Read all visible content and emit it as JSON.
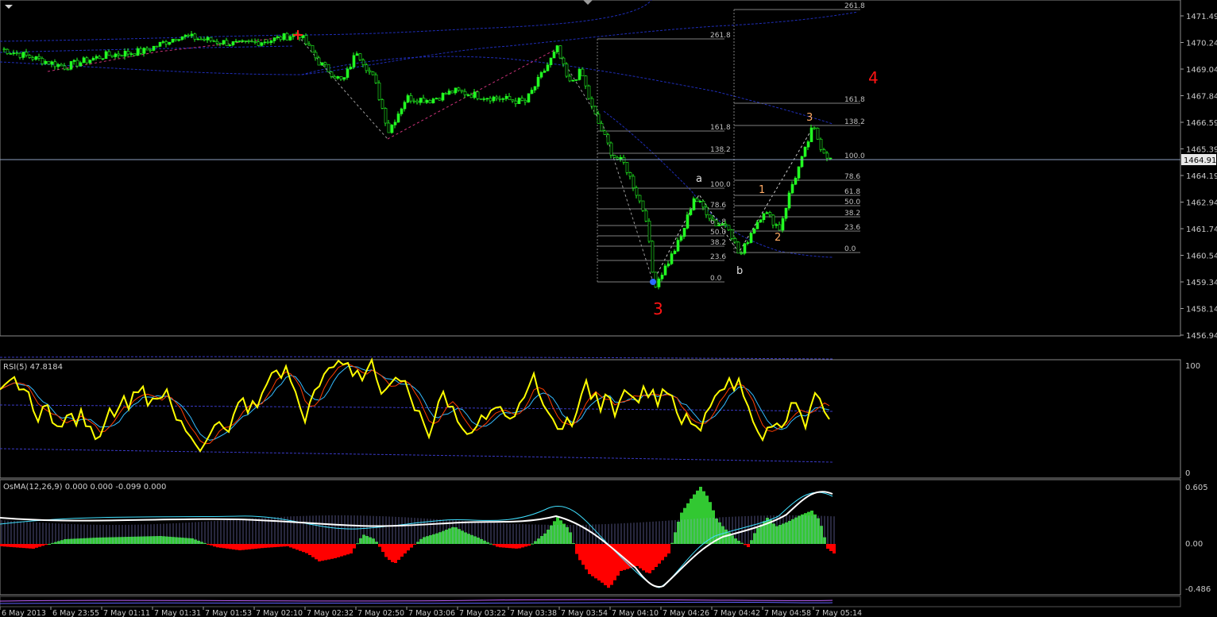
{
  "colors": {
    "background": "#000000",
    "grid": "#4c4c4c",
    "axis_text": "#c8c8c8",
    "bull_candle": "#22ff22",
    "bear_candle": "#00a800",
    "channel": "#1f2db8",
    "fib_line": "#808080",
    "fib_text": "#c0c0c0",
    "wave_major": "#ff1414",
    "wave_minor": "#ffaa64",
    "wave_letter": "#e0e0e0",
    "rsi_line": "#ffff00",
    "rsi_ma_fast": "#ff3c00",
    "rsi_ma_slow": "#33bbff",
    "rsi_band": "#3a3ac8",
    "osma_pos": "#32c832",
    "osma_neg": "#ff0000",
    "osma_signal_bar": "#a4a4ff",
    "macd_line": "#ffffff",
    "signal_line": "#40e0ff"
  },
  "price_axis": {
    "labels": [
      "1471.49",
      "1470.24",
      "1469.04",
      "1467.84",
      "1466.59",
      "1465.39",
      "1464.19",
      "1462.94",
      "1461.74",
      "1460.54",
      "1459.34",
      "1458.14",
      "1456.94"
    ],
    "current_price": "1464.91"
  },
  "time_axis": {
    "labels": [
      "6 May 2013",
      "6 May 23:55",
      "7 May 01:11",
      "7 May 01:31",
      "7 May 01:53",
      "7 May 02:10",
      "7 May 02:32",
      "7 May 02:50",
      "7 May 03:06",
      "7 May 03:22",
      "7 May 03:38",
      "7 May 03:54",
      "7 May 04:10",
      "7 May 04:26",
      "7 May 04:42",
      "7 May 04:58",
      "7 May 05:14"
    ]
  },
  "fib_sets": [
    {
      "levels": [
        "261.8",
        "161.8",
        "138.2",
        "100.0",
        "78.6",
        "61.8",
        "50.0",
        "38.2",
        "23.6",
        "0.0"
      ]
    },
    {
      "levels": [
        "261.8",
        "161.8",
        "138.2",
        "100.0",
        "78.6",
        "61.8",
        "50.0",
        "38.2",
        "23.6",
        "0.0"
      ]
    }
  ],
  "wave_labels": {
    "major_3": "3",
    "major_4": "4",
    "minor_1": "1",
    "minor_2": "2",
    "minor_3": "3",
    "letter_a": "a",
    "letter_b": "b"
  },
  "rsi": {
    "header": "RSI(5) 47.8184",
    "axis_max": "100",
    "axis_min": "0"
  },
  "osma": {
    "header": "OsMA(12,26,9) 0.000 0.000 -0.099 0.000",
    "axis_labels": [
      "0.605",
      "0.00",
      "-0.486"
    ]
  }
}
